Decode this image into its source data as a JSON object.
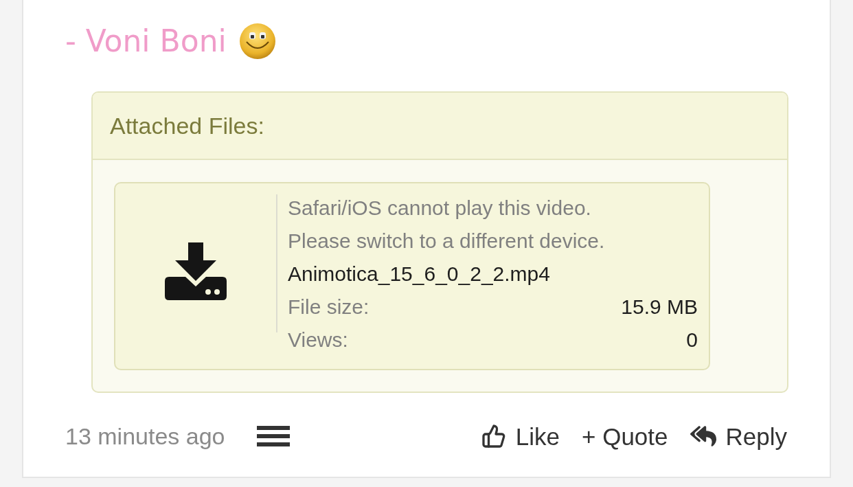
{
  "signature": {
    "text": "- Voni Boni"
  },
  "attachments": {
    "title": "Attached Files:",
    "files": [
      {
        "messages": [
          "Safari/iOS cannot play this video.",
          "Please switch to a different device."
        ],
        "filename": "Animotica_15_6_0_2_2.mp4",
        "details": [
          {
            "label": "File size:",
            "value": "15.9 MB"
          },
          {
            "label": "Views:",
            "value": "0"
          }
        ]
      }
    ]
  },
  "footer": {
    "time": "13 minutes ago",
    "actions": [
      {
        "kind": "like",
        "label": "Like"
      },
      {
        "kind": "quote",
        "label": "+ Quote"
      },
      {
        "kind": "reply",
        "label": "Reply"
      }
    ]
  }
}
